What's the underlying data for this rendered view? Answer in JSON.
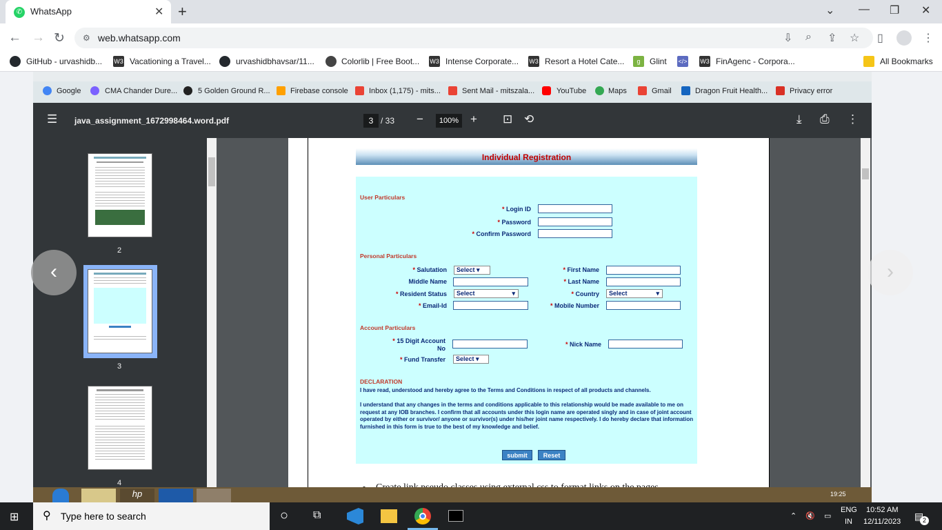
{
  "browser": {
    "tab_title": "WhatsApp",
    "url": "web.whatsapp.com",
    "bookmarks": [
      "GitHub - urvashidb...",
      "Vacationing a Travel...",
      "urvashidbhavsar/11...",
      "Colorlib | Free Boot...",
      "Intense Corporate...",
      "Resort a Hotel Cate...",
      "Glint",
      "FinAgenc - Corpora..."
    ],
    "all_bookmarks": "All Bookmarks"
  },
  "inner_bookmarks": [
    "Google",
    "CMA Chander Dure...",
    "5 Golden Ground R...",
    "Firebase console",
    "Inbox (1,175) - mits...",
    "Sent Mail - mitszala...",
    "YouTube",
    "Maps",
    "Gmail",
    "Dragon Fruit Health...",
    "Privacy error"
  ],
  "pdf": {
    "filename": "java_assignment_1672998464.word.pdf",
    "page": "3",
    "total": "/ 33",
    "zoom": "100%",
    "thumbs": [
      "2",
      "3",
      "4"
    ]
  },
  "form": {
    "heading": "Individual Registration",
    "user_particulars": "User Particulars",
    "login_id": "Login ID",
    "password": "Password",
    "confirm_password": "Confirm Password",
    "personal_particulars": "Personal Particulars",
    "salutation": "Salutation",
    "select": "Select",
    "first_name": "First Name",
    "middle_name": "Middle Name",
    "last_name": "Last Name",
    "resident_status": "Resident Status",
    "country": "Country",
    "email": "Email-Id",
    "mobile": "Mobile Number",
    "account_particulars": "Account Particulars",
    "digit_account": "15 Digit Account",
    "digit_account_2": "No",
    "nick_name": "Nick Name",
    "fund_transfer": "Fund Transfer",
    "declaration": "DECLARATION",
    "decl_1": "I have read, understood and hereby agree to the Terms and Conditions in respect of all products and channels.",
    "decl_2": "I understand that any changes in the terms and conditions applicable to this relationship would be made available to me on request at any IOB branches. I confirm that all accounts under this login name are operated singly and in case of joint account operated by either or survivor/ anyone or survivor(s) under his/her joint name respectively. I do hereby declare that information furnished in this form is true to the best of my knowledge and belief.",
    "submit": "submit",
    "reset": "Reset"
  },
  "page_text": "Create link pseudo classes using external css to format links on the pages",
  "inner_time": "19:25",
  "taskbar": {
    "search_placeholder": "Type here to search",
    "lang1": "ENG",
    "lang2": "IN",
    "time": "10:52 AM",
    "date": "12/11/2023",
    "notif": "2"
  }
}
